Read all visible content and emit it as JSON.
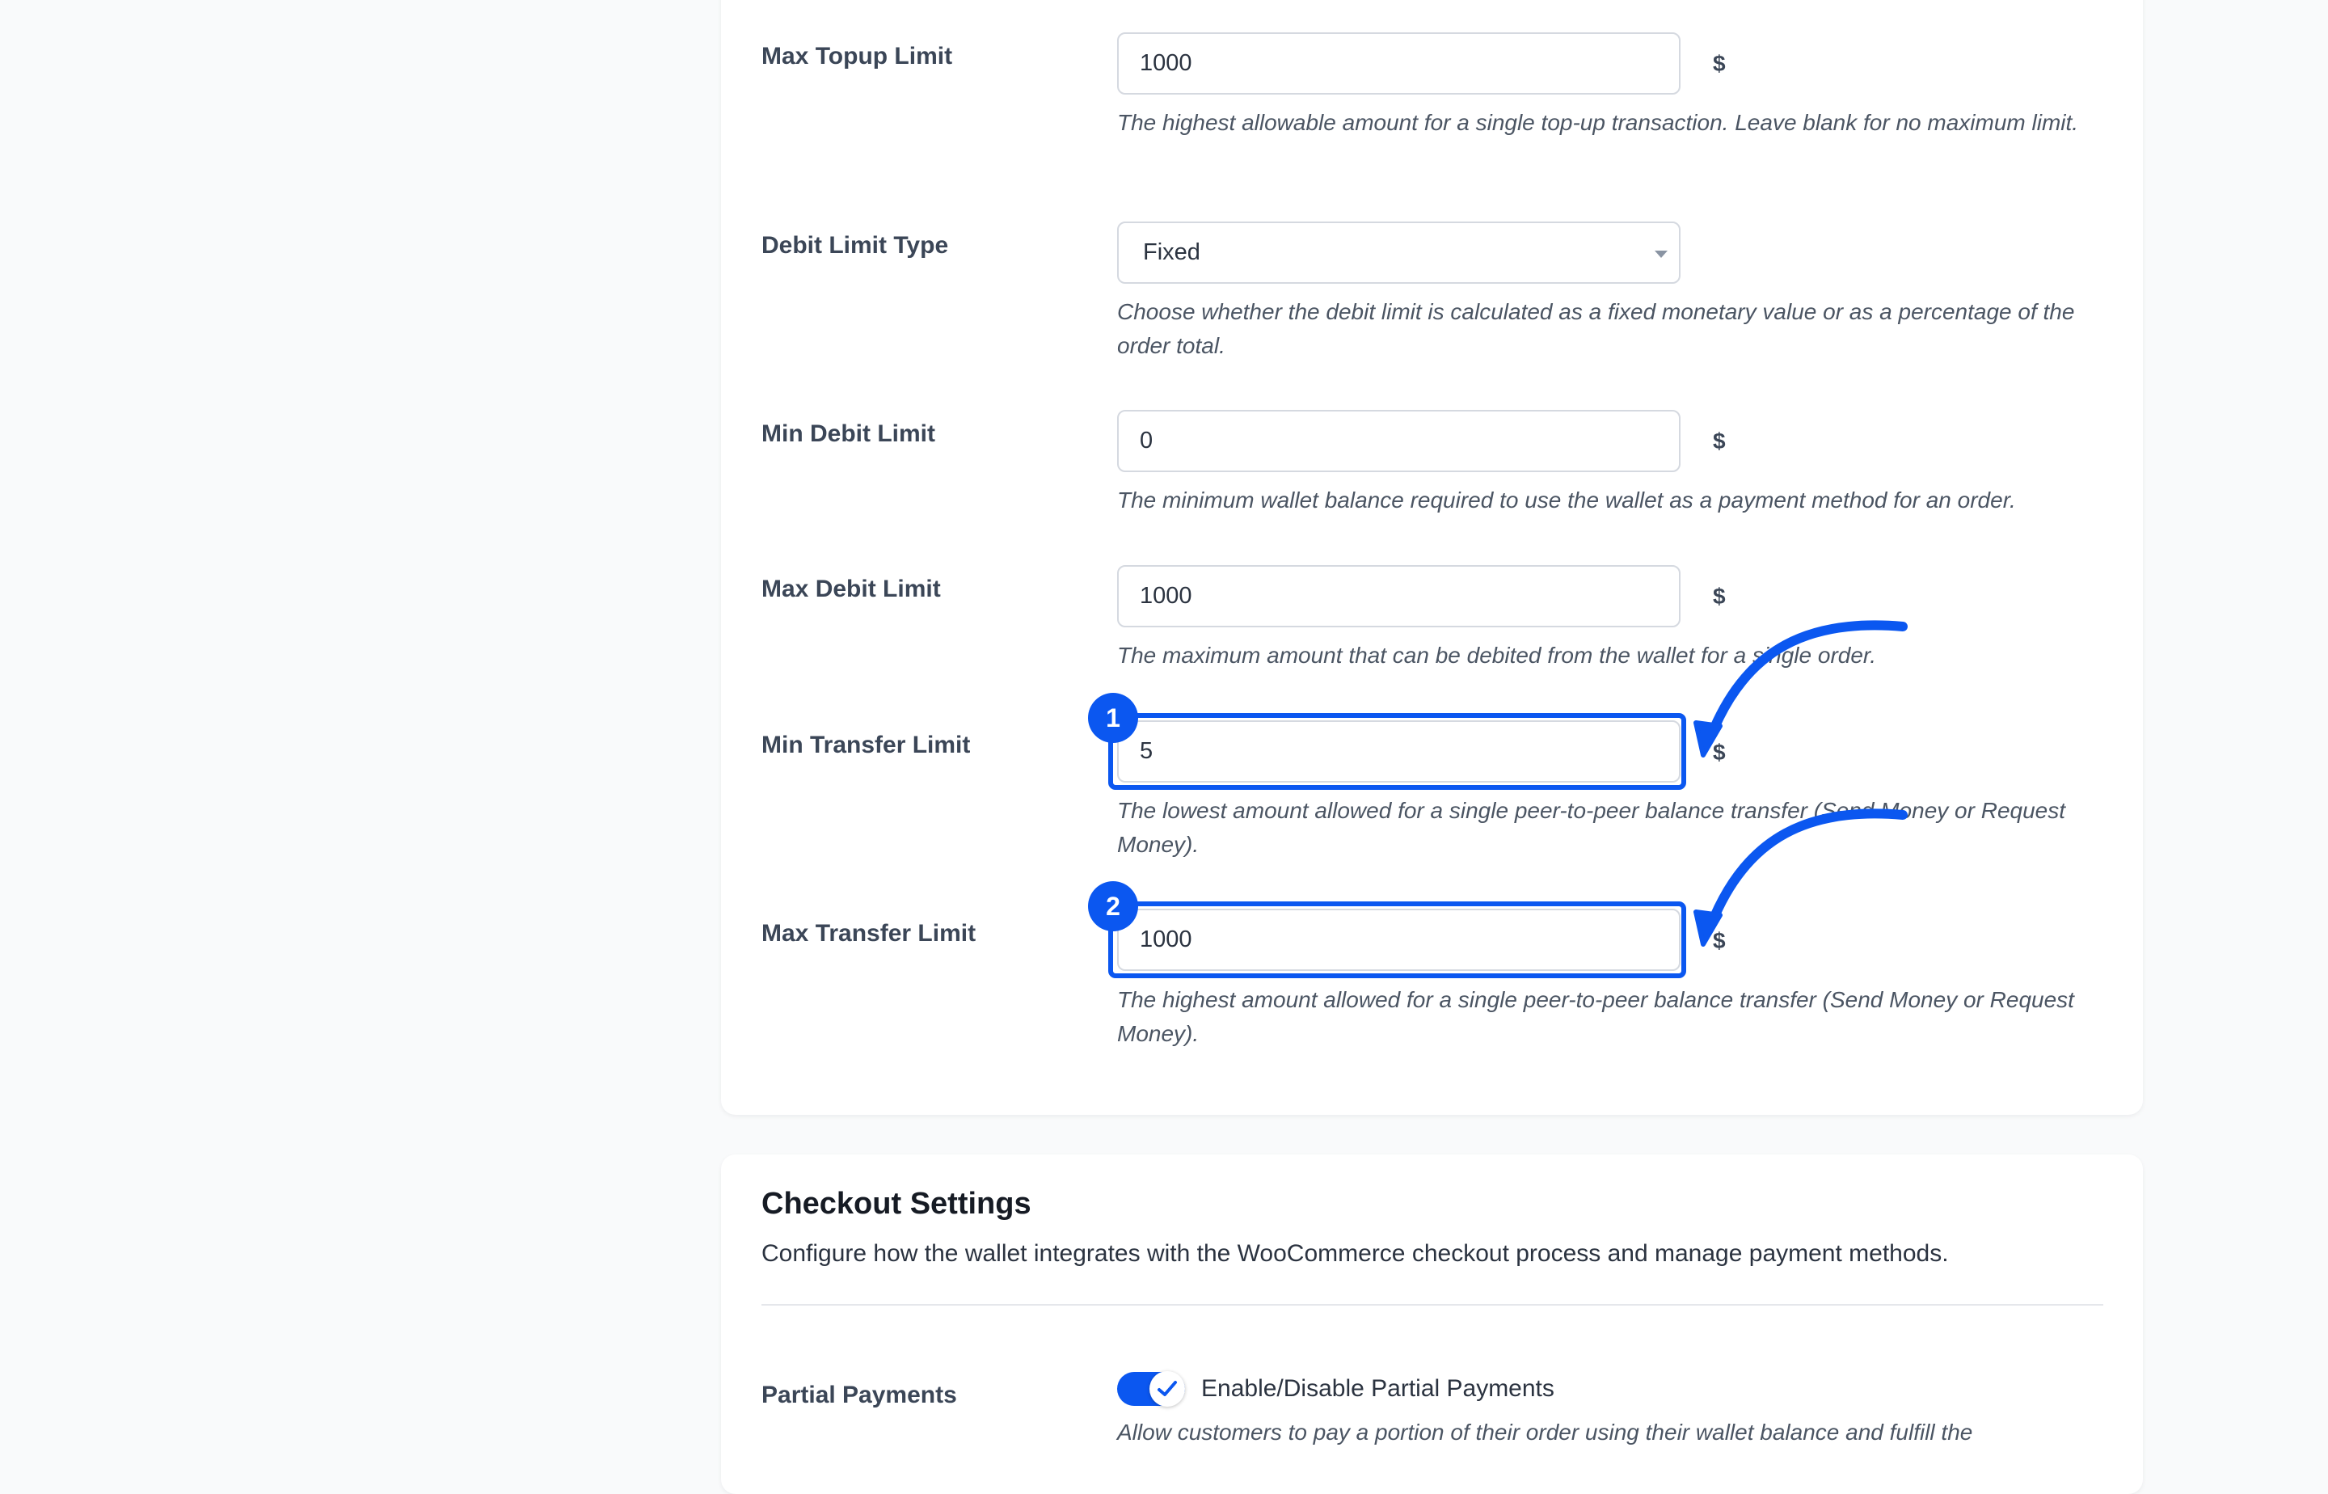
{
  "limits": {
    "max_topup": {
      "label": "Max Topup Limit",
      "value": "1000",
      "unit": "$",
      "help": "The highest allowable amount for a single top-up transaction. Leave blank for no maximum limit."
    },
    "debit_limit_type": {
      "label": "Debit Limit Type",
      "selected": "Fixed",
      "help": "Choose whether the debit limit is calculated as a fixed monetary value or as a percentage of the order total."
    },
    "min_debit": {
      "label": "Min Debit Limit",
      "value": "0",
      "unit": "$",
      "help": "The minimum wallet balance required to use the wallet as a payment method for an order."
    },
    "max_debit": {
      "label": "Max Debit Limit",
      "value": "1000",
      "unit": "$",
      "help": "The maximum amount that can be debited from the wallet for a single order."
    },
    "min_transfer": {
      "label": "Min Transfer Limit",
      "value": "5",
      "unit": "$",
      "help": "The lowest amount allowed for a single peer-to-peer balance transfer (Send Money or Request Money)."
    },
    "max_transfer": {
      "label": "Max Transfer Limit",
      "value": "1000",
      "unit": "$",
      "help": "The highest amount allowed for a single peer-to-peer balance transfer (Send Money or Request Money)."
    }
  },
  "annotations": {
    "badge_1": "1",
    "badge_2": "2",
    "color": "#0b57f0"
  },
  "checkout": {
    "title": "Checkout Settings",
    "description": "Configure how the wallet integrates with the WooCommerce checkout process and manage payment methods.",
    "partial_payments": {
      "label": "Partial Payments",
      "toggle_label": "Enable/Disable Partial Payments",
      "enabled": true,
      "help": "Allow customers to pay a portion of their order using their wallet balance and fulfill the"
    }
  }
}
